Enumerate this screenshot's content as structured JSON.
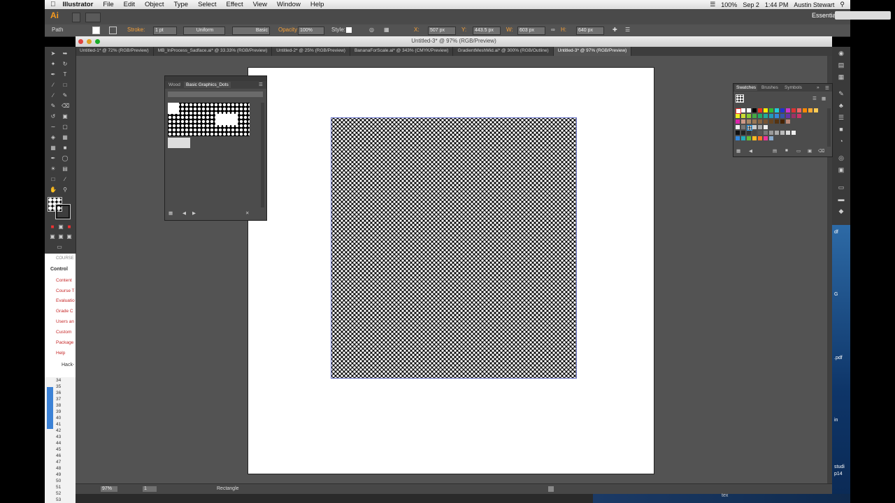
{
  "menubar": {
    "app": "Illustrator",
    "items": [
      "File",
      "Edit",
      "Object",
      "Type",
      "Select",
      "Effect",
      "View",
      "Window",
      "Help"
    ],
    "battery": "100%",
    "date": "Sep 2",
    "time": "1:44 PM",
    "user": "Austin Stewart"
  },
  "appbar": {
    "logo": "Ai",
    "workspace": "Essentials"
  },
  "controlbar": {
    "selection": "Path",
    "stroke_label": "Stroke:",
    "stroke_value": "1 pt",
    "profile": "Uniform",
    "brush": "Basic",
    "opacity_label": "Opacity:",
    "opacity_value": "100%",
    "style_label": "Style:",
    "x_label": "X:",
    "x_value": "507 px",
    "y_label": "Y:",
    "y_value": "443.5 px",
    "w_label": "W:",
    "w_value": "603 px",
    "h_label": "H:",
    "h_value": "640 px"
  },
  "document": {
    "title": "Untitled-3* @ 97% (RGB/Preview)",
    "tabs": [
      "Untitled-1* @ 72% (RGB/Preview)",
      "MB_InProcess_Sadface.ai* @ 33.33% (RGB/Preview)",
      "Untitled-2* @ 25% (RGB/Preview)",
      "BananaForScale.ai* @ 343% (CMYK/Preview)",
      "GradientMeshMid.ai* @ 300% (RGB/Outline)",
      "Untitled-3* @ 97% (RGB/Preview)"
    ],
    "active_tab": 5
  },
  "statusbar": {
    "zoom": "97%",
    "artboard": "1",
    "tool": "Rectangle"
  },
  "graphic_styles_panel": {
    "tab1": "Wood",
    "tab2": "Basic Graphics_Dots"
  },
  "swatches_panel": {
    "tab1": "Swatches",
    "tab2": "Brushes",
    "tab3": "Symbols"
  },
  "background_browser": {
    "header": "COURSE",
    "active": "Control",
    "items": [
      "Content",
      "Course T",
      "Evaluatio",
      "Grade C",
      "Users an",
      "Custom",
      "Package",
      "Help"
    ],
    "footer": "Hack-"
  },
  "spreadsheet_rows": [
    "34",
    "35",
    "36",
    "37",
    "38",
    "39",
    "40",
    "41",
    "42",
    "43",
    "44",
    "45",
    "46",
    "47",
    "48",
    "49",
    "50",
    "51",
    "52",
    "53"
  ],
  "desktop_labels": [
    "df",
    "G",
    ".pdf",
    "in",
    "studi",
    "p14",
    "tex"
  ]
}
